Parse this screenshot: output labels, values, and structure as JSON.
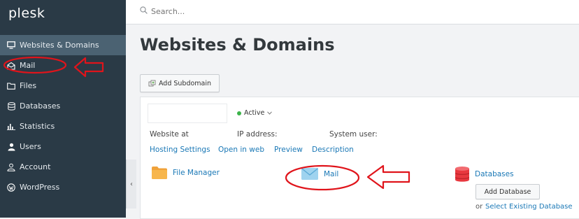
{
  "sidebar": {
    "logo": "plesk",
    "items": [
      {
        "label": "Websites & Domains",
        "icon": "monitor-icon"
      },
      {
        "label": "Mail",
        "icon": "mail-icon"
      },
      {
        "label": "Files",
        "icon": "folder-icon"
      },
      {
        "label": "Databases",
        "icon": "database-icon"
      },
      {
        "label": "Statistics",
        "icon": "statistics-icon"
      },
      {
        "label": "Users",
        "icon": "user-icon"
      },
      {
        "label": "Account",
        "icon": "account-icon"
      },
      {
        "label": "WordPress",
        "icon": "wordpress-icon"
      }
    ],
    "collapse_glyph": "‹"
  },
  "topbar": {
    "search_placeholder": "Search..."
  },
  "page": {
    "title": "Websites & Domains"
  },
  "toolbar": {
    "add_subdomain": "Add Subdomain"
  },
  "domain": {
    "status": "Active",
    "website_at_label": "Website at",
    "ip_label": "IP address:",
    "system_user_label": "System user:",
    "links": [
      "Hosting Settings",
      "Open in web",
      "Preview",
      "Description"
    ]
  },
  "tools": {
    "file_manager": "File Manager",
    "mail": "Mail",
    "databases": "Databases",
    "add_database": "Add Database",
    "or_text": "or",
    "select_existing": "Select Existing Database"
  },
  "colors": {
    "sidebar_bg": "#2a3a46",
    "sidebar_active": "#4b6272",
    "link": "#1a78b6",
    "annotation_red": "#e0141b",
    "active_dot": "#3cb34a"
  }
}
